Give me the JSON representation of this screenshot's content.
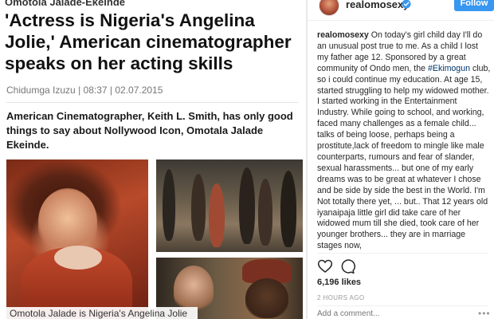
{
  "article": {
    "kicker": "Omotola Jalade-Ekeinde",
    "headline": "'Actress is Nigeria's Angelina Jolie,' American cinematographer speaks on her acting skills",
    "author": "Chidumga Izuzu",
    "time": "08:37",
    "date": "02.07.2015",
    "lead": "American Cinematographer, Keith L. Smith, has only good things to say about Nollywood Icon, Omotala Jalade Ekeinde.",
    "photo_caption": "Omotola Jalade is Nigeria's Angelina Jolie"
  },
  "instagram": {
    "username": "realomosexy",
    "verified_icon": "verified-badge-icon",
    "follow_label": "Follow",
    "caption_user": "realomosexy",
    "caption_part1": "On today's girl child day I'll do an unusual post true to me. As a child I lost my father age 12. Sponsored by a great community of Ondo men, the",
    "caption_hashtag": "#Ekimogun",
    "caption_part2": "club, so i could continue my education. At age 15, started struggling to help my widowed mother. I started working in the Entertainment Industry. While going to school, and working, faced many challenges as a female child... talks of being loose, perhaps being a prostitute,lack of freedom to mingle like male counterparts, rumours and fear of slander, sexual harassments... but one of my early dreams was to be great at whatever I chose and be side by side the best in the World. I'm Not totally there yet, ... but.. That 12 years old iyanaipaja little girl did take care of her widowed mum till she died, took care of her younger brothers... they are in marriage stages now,",
    "likes": "6,196 likes",
    "time_ago": "2 HOURS AGO",
    "comment_placeholder": "Add a comment...",
    "more_label": "•••",
    "accent_color": "#3897f0"
  }
}
